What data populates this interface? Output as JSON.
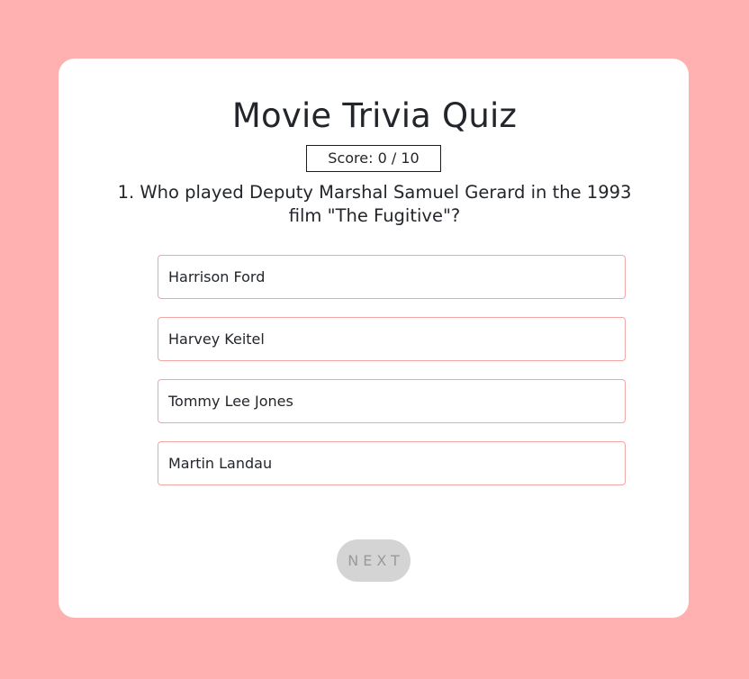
{
  "quiz": {
    "title": "Movie Trivia Quiz",
    "score_text": "Score: 0 / 10",
    "question": {
      "text": "1. Who played Deputy Marshal Samuel Gerard in the 1993 film \"The Fugitive\"?"
    },
    "answers": [
      {
        "label": "Harrison Ford"
      },
      {
        "label": "Harvey Keitel"
      },
      {
        "label": "Tommy Lee Jones"
      },
      {
        "label": "Martin Landau"
      }
    ],
    "next_label": "NEXT"
  },
  "colors": {
    "background": "#ffb0b0",
    "card": "#ffffff",
    "answer_border": "#f2a5a5",
    "next_button_bg": "#d4d4d4",
    "next_button_text": "#9a9a9a",
    "text": "#22262b"
  }
}
